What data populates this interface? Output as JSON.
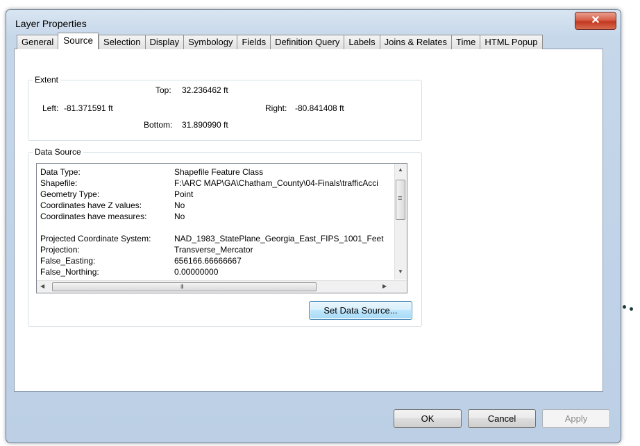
{
  "window": {
    "title": "Layer Properties",
    "close_glyph": "✕"
  },
  "tabs": [
    {
      "label": "General",
      "active": false
    },
    {
      "label": "Source",
      "active": true
    },
    {
      "label": "Selection",
      "active": false
    },
    {
      "label": "Display",
      "active": false
    },
    {
      "label": "Symbology",
      "active": false
    },
    {
      "label": "Fields",
      "active": false
    },
    {
      "label": "Definition Query",
      "active": false
    },
    {
      "label": "Labels",
      "active": false
    },
    {
      "label": "Joins & Relates",
      "active": false
    },
    {
      "label": "Time",
      "active": false
    },
    {
      "label": "HTML Popup",
      "active": false
    }
  ],
  "extent": {
    "group_label": "Extent",
    "top_label": "Top:",
    "top_value": "32.236462 ft",
    "left_label": "Left:",
    "left_value": "-81.371591 ft",
    "right_label": "Right:",
    "right_value": "-80.841408 ft",
    "bottom_label": "Bottom:",
    "bottom_value": "31.890990 ft"
  },
  "data_source": {
    "group_label": "Data Source",
    "rows": [
      {
        "key": "Data Type:",
        "value": "Shapefile Feature Class"
      },
      {
        "key": "Shapefile:",
        "value": "F:\\ARC MAP\\GA\\Chatham_County\\04-Finals\\trafficAcci"
      },
      {
        "key": "Geometry Type:",
        "value": "Point"
      },
      {
        "key": "Coordinates have Z values:",
        "value": "No"
      },
      {
        "key": "Coordinates have measures:",
        "value": "No"
      },
      {
        "key": "",
        "value": ""
      },
      {
        "key": "Projected Coordinate System:",
        "value": "NAD_1983_StatePlane_Georgia_East_FIPS_1001_Feet"
      },
      {
        "key": "Projection:",
        "value": "Transverse_Mercator"
      },
      {
        "key": "False_Easting:",
        "value": "656166.66666667"
      },
      {
        "key": "False_Northing:",
        "value": "0.00000000"
      }
    ],
    "set_button": "Set Data Source...",
    "scroll_up": "▲",
    "scroll_down": "▼",
    "scroll_left": "◀",
    "scroll_right": "▶",
    "hgrip": "III",
    "vgrip": "≡"
  },
  "buttons": {
    "ok": "OK",
    "cancel": "Cancel",
    "apply": "Apply"
  }
}
